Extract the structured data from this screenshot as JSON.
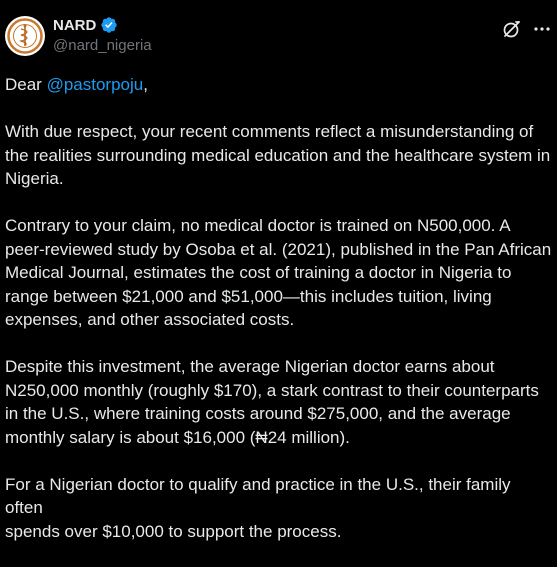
{
  "author": {
    "display_name": "NARD",
    "handle": "@nard_nigeria",
    "verified": true
  },
  "icons": {
    "avatar": "nard-logo-avatar",
    "verified": "verified-badge-icon",
    "grok": "grok-icon",
    "more": "more-options-icon"
  },
  "colors": {
    "background": "#000000",
    "text": "#e7e9ea",
    "secondary_text": "#71767b",
    "accent": "#1d9bf0"
  },
  "tweet": {
    "greeting_prefix": "Dear ",
    "mention": "@pastorpoju",
    "greeting_suffix": ",",
    "paragraphs": [
      "With due respect, your recent comments reflect a misunderstanding of\nthe realities surrounding medical education and the healthcare system in\nNigeria.",
      "Contrary to your claim, no medical doctor is trained on N500,000. A\npeer-reviewed study by Osoba et al. (2021), published in the Pan African\nMedical Journal, estimates the cost of training a doctor in Nigeria to\nrange between $21,000 and $51,000—this includes tuition, living\nexpenses, and other associated costs.",
      "Despite this investment, the average Nigerian doctor earns about\nN250,000 monthly (roughly $170), a stark contrast to their counterparts\nin the U.S., where training costs around $275,000, and the average\nmonthly salary is about $16,000 (₦24 million).",
      "For a Nigerian doctor to qualify and practice in the U.S., their family often\nspends over $10,000 to support the process."
    ]
  }
}
